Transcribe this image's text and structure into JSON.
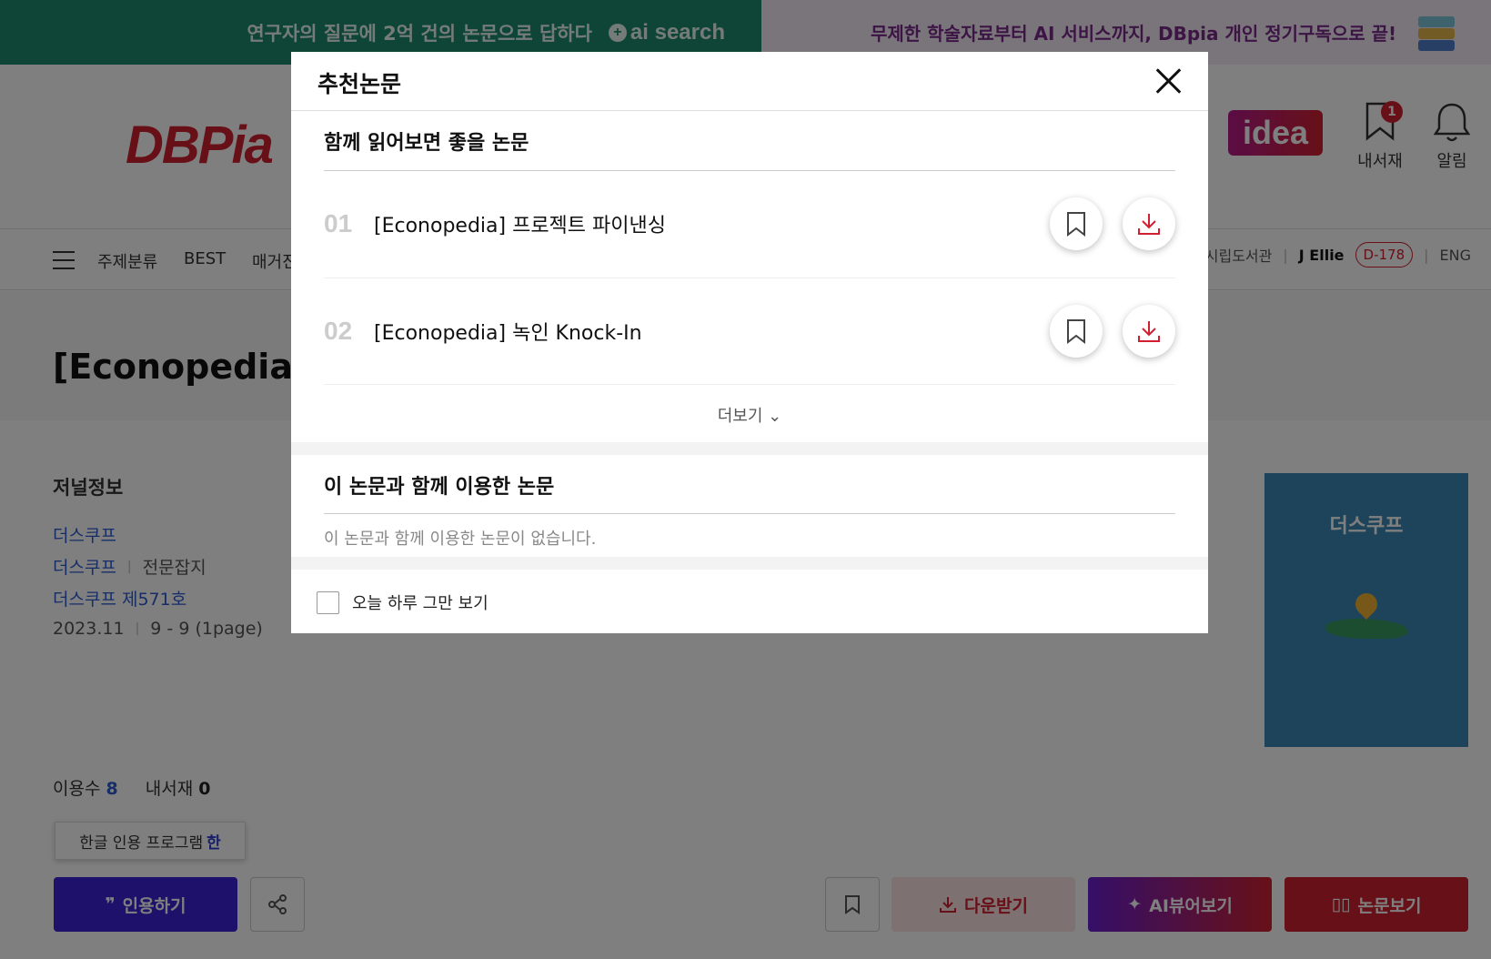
{
  "banner": {
    "left_text": "연구자의 질문에 2억 건의 논문으로 답하다",
    "left_brand": "ai search",
    "right_text": "무제한 학술자료부터 AI 서비스까지, DBpia 개인 정기구독으로 끝!"
  },
  "header": {
    "logo": "DBPia",
    "idea_label": "idea",
    "library_label": "내서재",
    "library_badge": "1",
    "alarm_label": "알림"
  },
  "nav": {
    "items": [
      "주제분류",
      "BEST",
      "매거진"
    ],
    "right": {
      "library_name": "시립도서관",
      "user": "J Ellie",
      "dday": "D-178",
      "lang": "ENG"
    }
  },
  "page": {
    "title": "[Econopedia] 김"
  },
  "journal": {
    "heading": "저널정보",
    "publisher": "더스쿠프",
    "journal_name": "더스쿠프",
    "journal_type": "전문잡지",
    "issue": "더스쿠프 제571호",
    "date": "2023.11",
    "pages": "9 - 9 (1page)",
    "cover_title": "더스쿠프"
  },
  "stats": {
    "usage_label": "이용수",
    "usage_value": "8",
    "library_label": "내서재",
    "library_value": "0"
  },
  "tooltip": {
    "text": "한글 인용 프로그램",
    "highlight": "한"
  },
  "actions": {
    "cite": "인용하기",
    "download": "다운받기",
    "ai_view": "AI뷰어보기",
    "view": "논문보기"
  },
  "modal": {
    "title": "추천논문",
    "section1_title": "함께 읽어보면 좋을 논문",
    "items": [
      {
        "num": "01",
        "title": "[Econopedia] 프로젝트 파이낸싱"
      },
      {
        "num": "02",
        "title": "[Econopedia] 녹인 Knock-In"
      }
    ],
    "more": "더보기",
    "section2_title": "이 논문과 함께 이용한 논문",
    "section2_empty": "이 논문과 함께 이용한 논문이 없습니다.",
    "dont_show_today": "오늘 하루 그만 보기"
  },
  "colors": {
    "brand_red": "#d0202f",
    "banner_green": "#1e8a6e",
    "cite_blue": "#3d23d8",
    "link_blue": "#2c5bd0"
  }
}
